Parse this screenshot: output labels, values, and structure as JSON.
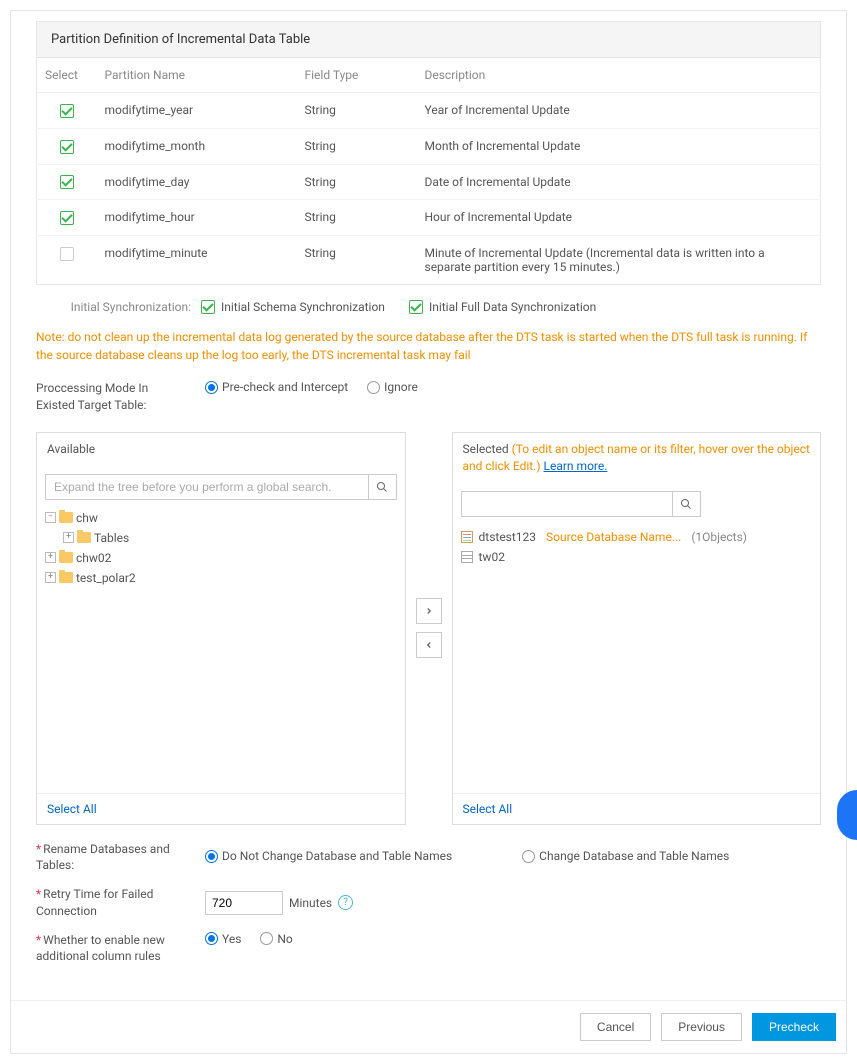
{
  "panel": {
    "title": "Partition Definition of Incremental Data Table"
  },
  "columns": {
    "select": "Select",
    "name": "Partition Name",
    "type": "Field Type",
    "desc": "Description"
  },
  "rows": [
    {
      "checked": true,
      "name": "modifytime_year",
      "type": "String",
      "desc": "Year of Incremental Update"
    },
    {
      "checked": true,
      "name": "modifytime_month",
      "type": "String",
      "desc": "Month of Incremental Update"
    },
    {
      "checked": true,
      "name": "modifytime_day",
      "type": "String",
      "desc": "Date of Incremental Update"
    },
    {
      "checked": true,
      "name": "modifytime_hour",
      "type": "String",
      "desc": "Hour of Incremental Update"
    },
    {
      "checked": false,
      "name": "modifytime_minute",
      "type": "String",
      "desc": "Minute of Incremental Update (Incremental data is written into a separate partition every 15 minutes.)"
    }
  ],
  "sync": {
    "label": "Initial Synchronization:",
    "schema": "Initial Schema Synchronization",
    "full": "Initial Full Data Synchronization"
  },
  "note": "Note: do not clean up the incremental data log generated by the source database after the DTS task is started when the DTS full task is running. If the source database cleans up the log too early, the DTS incremental task may fail",
  "procMode": {
    "label": "Proccessing Mode In\nExisted Target Table:",
    "opt1": "Pre-check and Intercept",
    "opt2": "Ignore"
  },
  "available": {
    "title": "Available",
    "placeholder": "Expand the tree before you perform a global search.",
    "tree": {
      "n0": "chw",
      "n0_0": "Tables",
      "n1": "chw02",
      "n2": "test_polar2"
    },
    "selectAll": "Select All"
  },
  "selected": {
    "title": "Selected",
    "hint": "(To edit an object name or its filter, hover over the object and click Edit.)",
    "learn": "Learn more.",
    "items": {
      "i0": "dtstest123",
      "i0_extra": "Source Database Name...",
      "i0_count": "(1Objects)",
      "i1": "tw02"
    },
    "selectAll": "Select All"
  },
  "rename": {
    "label": "Rename Databases and Tables:",
    "opt1": "Do Not Change Database and Table Names",
    "opt2": "Change Database and Table Names"
  },
  "retry": {
    "label": "Retry Time for Failed Connection",
    "value": "720",
    "unit": "Minutes"
  },
  "newCol": {
    "label": "Whether to enable new additional column rules",
    "yes": "Yes",
    "no": "No"
  },
  "buttons": {
    "cancel": "Cancel",
    "previous": "Previous",
    "precheck": "Precheck"
  }
}
